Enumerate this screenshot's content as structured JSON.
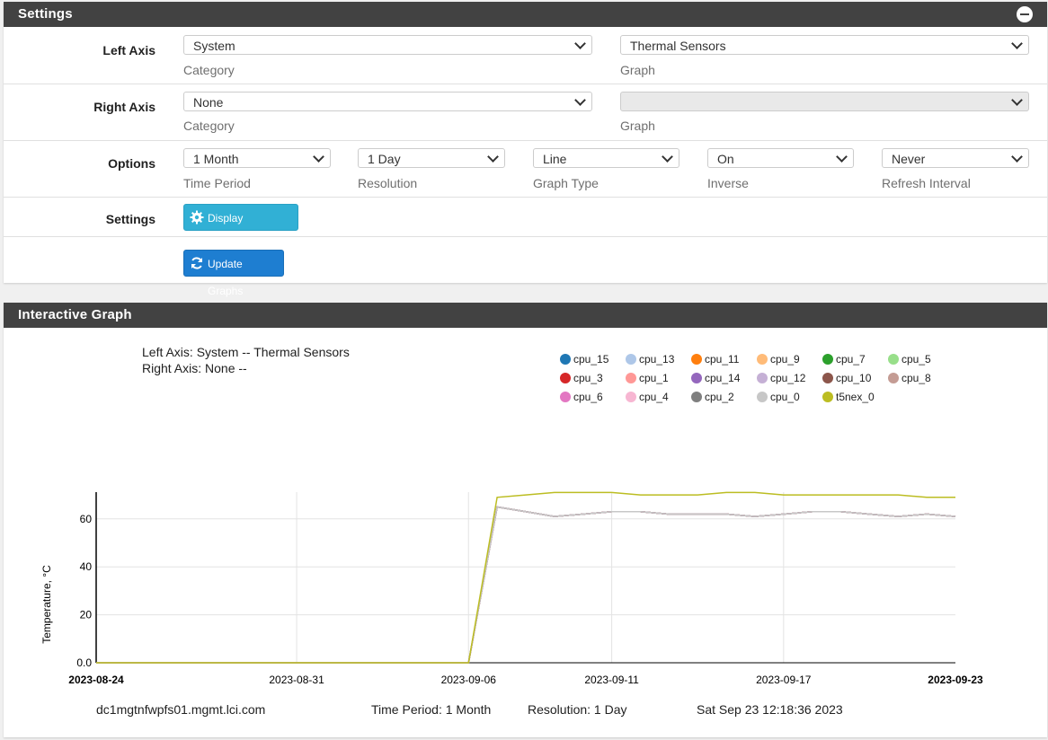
{
  "settings": {
    "title": "Settings",
    "left_axis": {
      "label": "Left Axis",
      "category": "System",
      "category_help": "Category",
      "graph": "Thermal Sensors",
      "graph_help": "Graph"
    },
    "right_axis": {
      "label": "Right Axis",
      "category": "None",
      "category_help": "Category",
      "graph": "",
      "graph_help": "Graph"
    },
    "options": {
      "label": "Options",
      "time_period": "1 Month",
      "time_period_help": "Time Period",
      "resolution": "1 Day",
      "resolution_help": "Resolution",
      "graph_type": "Line",
      "graph_type_help": "Graph Type",
      "inverse": "On",
      "inverse_help": "Inverse",
      "refresh": "Never",
      "refresh_help": "Refresh Interval"
    },
    "settings_row": {
      "label": "Settings",
      "advanced_button": "Display Advanced"
    },
    "update_button": "Update Graphs"
  },
  "graph_panel": {
    "title": "Interactive Graph",
    "left_axis_info": "Left Axis: System -- Thermal Sensors",
    "right_axis_info": "Right Axis: None --",
    "host": "dc1mgtnfwpfs01.mgmt.lci.com",
    "time_period_info": "Time Period: 1 Month",
    "resolution_info": "Resolution: 1 Day",
    "timestamp": "Sat Sep 23 12:18:36 2023"
  },
  "colors": {
    "header_bg": "#424242",
    "info_button": "#31b0d5",
    "primary_button": "#1e7ed1"
  },
  "chart_data": {
    "type": "line",
    "ylabel": "Temperature, °C",
    "xlabel": "",
    "ylim": [
      0,
      70
    ],
    "y_ticks": [
      "0.0",
      "20",
      "40",
      "60"
    ],
    "y_tick_values": [
      0,
      20,
      40,
      60
    ],
    "x_ticks": [
      "2023-08-24",
      "2023-08-31",
      "2023-09-06",
      "2023-09-11",
      "2023-09-17",
      "2023-09-23"
    ],
    "x_tick_dates": [
      "2023-08-24",
      "2023-08-31",
      "2023-09-06",
      "2023-09-11",
      "2023-09-17",
      "2023-09-23"
    ],
    "grid": true,
    "legend_position": "top-right",
    "x": [
      "2023-08-24",
      "2023-08-25",
      "2023-08-26",
      "2023-08-27",
      "2023-08-28",
      "2023-08-29",
      "2023-08-30",
      "2023-08-31",
      "2023-09-01",
      "2023-09-02",
      "2023-09-03",
      "2023-09-04",
      "2023-09-05",
      "2023-09-06",
      "2023-09-07",
      "2023-09-08",
      "2023-09-09",
      "2023-09-10",
      "2023-09-11",
      "2023-09-12",
      "2023-09-13",
      "2023-09-14",
      "2023-09-15",
      "2023-09-16",
      "2023-09-17",
      "2023-09-18",
      "2023-09-19",
      "2023-09-20",
      "2023-09-21",
      "2023-09-22",
      "2023-09-23"
    ],
    "series": [
      {
        "name": "cpu_15",
        "color": "#1f77b4",
        "values": [
          0,
          0,
          0,
          0,
          0,
          0,
          0,
          0,
          0,
          0,
          0,
          0,
          0,
          0,
          65,
          63,
          61,
          62,
          63,
          63,
          62,
          62,
          62,
          61,
          62,
          63,
          63,
          62,
          61,
          62,
          61
        ]
      },
      {
        "name": "cpu_13",
        "color": "#aec7e8",
        "values": [
          0,
          0,
          0,
          0,
          0,
          0,
          0,
          0,
          0,
          0,
          0,
          0,
          0,
          0,
          65,
          63,
          61,
          62,
          63,
          63,
          62,
          62,
          62,
          61,
          62,
          63,
          63,
          62,
          61,
          62,
          61
        ]
      },
      {
        "name": "cpu_11",
        "color": "#ff7f0e",
        "values": [
          0,
          0,
          0,
          0,
          0,
          0,
          0,
          0,
          0,
          0,
          0,
          0,
          0,
          0,
          65,
          63,
          61,
          62,
          63,
          63,
          62,
          62,
          62,
          61,
          62,
          63,
          63,
          62,
          61,
          62,
          61
        ]
      },
      {
        "name": "cpu_9",
        "color": "#ffbb78",
        "values": [
          0,
          0,
          0,
          0,
          0,
          0,
          0,
          0,
          0,
          0,
          0,
          0,
          0,
          0,
          65,
          63,
          61,
          62,
          63,
          63,
          62,
          62,
          62,
          61,
          62,
          63,
          63,
          62,
          61,
          62,
          61
        ]
      },
      {
        "name": "cpu_7",
        "color": "#2ca02c",
        "values": [
          0,
          0,
          0,
          0,
          0,
          0,
          0,
          0,
          0,
          0,
          0,
          0,
          0,
          0,
          65,
          63,
          61,
          62,
          63,
          63,
          62,
          62,
          62,
          61,
          62,
          63,
          63,
          62,
          61,
          62,
          61
        ]
      },
      {
        "name": "cpu_5",
        "color": "#98df8a",
        "values": [
          0,
          0,
          0,
          0,
          0,
          0,
          0,
          0,
          0,
          0,
          0,
          0,
          0,
          0,
          65,
          63,
          61,
          62,
          63,
          63,
          62,
          62,
          62,
          61,
          62,
          63,
          63,
          62,
          61,
          62,
          61
        ]
      },
      {
        "name": "cpu_3",
        "color": "#d62728",
        "values": [
          0,
          0,
          0,
          0,
          0,
          0,
          0,
          0,
          0,
          0,
          0,
          0,
          0,
          0,
          65,
          63,
          61,
          62,
          63,
          63,
          62,
          62,
          62,
          61,
          62,
          63,
          63,
          62,
          61,
          62,
          61
        ]
      },
      {
        "name": "cpu_1",
        "color": "#ff9896",
        "values": [
          0,
          0,
          0,
          0,
          0,
          0,
          0,
          0,
          0,
          0,
          0,
          0,
          0,
          0,
          65,
          63,
          61,
          62,
          63,
          63,
          62,
          62,
          62,
          61,
          62,
          63,
          63,
          62,
          61,
          62,
          61
        ]
      },
      {
        "name": "cpu_14",
        "color": "#9467bd",
        "values": [
          0,
          0,
          0,
          0,
          0,
          0,
          0,
          0,
          0,
          0,
          0,
          0,
          0,
          0,
          65,
          63,
          61,
          62,
          63,
          63,
          62,
          62,
          62,
          61,
          62,
          63,
          63,
          62,
          61,
          62,
          61
        ]
      },
      {
        "name": "cpu_12",
        "color": "#c5b0d5",
        "values": [
          0,
          0,
          0,
          0,
          0,
          0,
          0,
          0,
          0,
          0,
          0,
          0,
          0,
          0,
          65,
          63,
          61,
          62,
          63,
          63,
          62,
          62,
          62,
          61,
          62,
          63,
          63,
          62,
          61,
          62,
          61
        ]
      },
      {
        "name": "cpu_10",
        "color": "#8c564b",
        "values": [
          0,
          0,
          0,
          0,
          0,
          0,
          0,
          0,
          0,
          0,
          0,
          0,
          0,
          0,
          65,
          63,
          61,
          62,
          63,
          63,
          62,
          62,
          62,
          61,
          62,
          63,
          63,
          62,
          61,
          62,
          61
        ]
      },
      {
        "name": "cpu_8",
        "color": "#c49c94",
        "values": [
          0,
          0,
          0,
          0,
          0,
          0,
          0,
          0,
          0,
          0,
          0,
          0,
          0,
          0,
          65,
          63,
          61,
          62,
          63,
          63,
          62,
          62,
          62,
          61,
          62,
          63,
          63,
          62,
          61,
          62,
          61
        ]
      },
      {
        "name": "cpu_6",
        "color": "#e377c2",
        "values": [
          0,
          0,
          0,
          0,
          0,
          0,
          0,
          0,
          0,
          0,
          0,
          0,
          0,
          0,
          65,
          63,
          61,
          62,
          63,
          63,
          62,
          62,
          62,
          61,
          62,
          63,
          63,
          62,
          61,
          62,
          61
        ]
      },
      {
        "name": "cpu_4",
        "color": "#f7b6d2",
        "values": [
          0,
          0,
          0,
          0,
          0,
          0,
          0,
          0,
          0,
          0,
          0,
          0,
          0,
          0,
          65,
          63,
          61,
          62,
          63,
          63,
          62,
          62,
          62,
          61,
          62,
          63,
          63,
          62,
          61,
          62,
          61
        ]
      },
      {
        "name": "cpu_2",
        "color": "#7f7f7f",
        "values": [
          0,
          0,
          0,
          0,
          0,
          0,
          0,
          0,
          0,
          0,
          0,
          0,
          0,
          0,
          65,
          63,
          61,
          62,
          63,
          63,
          62,
          62,
          62,
          61,
          62,
          63,
          63,
          62,
          61,
          62,
          61
        ]
      },
      {
        "name": "cpu_0",
        "color": "#c7c7c7",
        "values": [
          0,
          0,
          0,
          0,
          0,
          0,
          0,
          0,
          0,
          0,
          0,
          0,
          0,
          0,
          65,
          63,
          61,
          62,
          63,
          63,
          62,
          62,
          62,
          61,
          62,
          63,
          63,
          62,
          61,
          62,
          61
        ]
      },
      {
        "name": "t5nex_0",
        "color": "#bcbd22",
        "values": [
          0,
          0,
          0,
          0,
          0,
          0,
          0,
          0,
          0,
          0,
          0,
          0,
          0,
          0,
          69,
          70,
          71,
          71,
          71,
          70,
          70,
          70,
          71,
          71,
          70,
          70,
          70,
          70,
          70,
          69,
          69
        ]
      }
    ]
  }
}
